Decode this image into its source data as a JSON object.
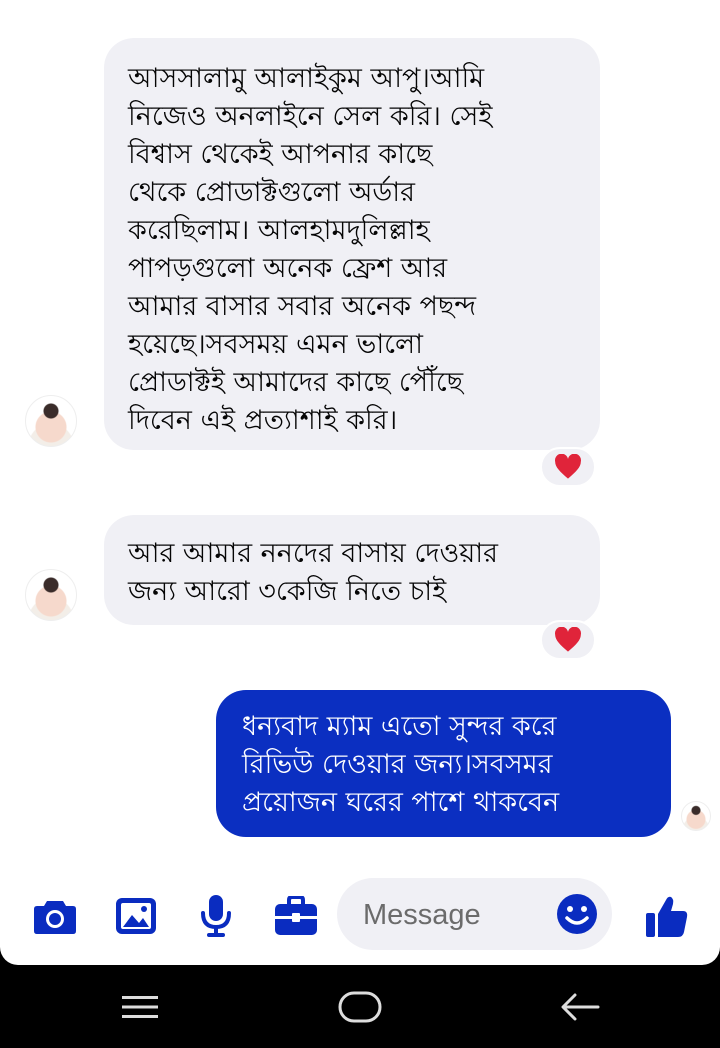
{
  "messages": [
    {
      "sender": "contact",
      "lines": [
        "আসসালামু আলাইকুম আপু।আমি",
        "নিজেও অনলাইনে সেল করি। সেই",
        "বিশ্বাস থেকেই আপনার কাছে",
        "থেকে প্রোডাক্টগুলো অর্ডার",
        "করেছিলাম। আলহামদুলিল্লাহ",
        "পাপড়গুলো  অনেক ফ্রেশ আর",
        "আমার বাসার সবার অনেক পছন্দ",
        "হয়েছে।সবসময় এমন ভালো",
        "প্রোডাক্টই আমাদের কাছে পৌঁছে",
        "দিবেন এই প্রত্যাশাই করি।"
      ],
      "reaction": "heart"
    },
    {
      "sender": "contact",
      "lines": [
        "আর আমার ননদের বাসায় দেওয়ার",
        "জন্য আরো ৩কেজি নিতে চাই"
      ],
      "reaction": "heart"
    },
    {
      "sender": "self",
      "lines": [
        "ধন্যবাদ ম্যাম এতো সুন্দর করে",
        "রিভিউ দেওয়ার জন্য।সবসমর",
        "প্রয়োজন ঘরের পাশে থাকবেন"
      ]
    }
  ],
  "composer": {
    "placeholder": "Message",
    "icons": [
      "camera-icon",
      "image-icon",
      "microphone-icon",
      "briefcase-icon",
      "emoji-icon",
      "thumbs-up-icon"
    ]
  },
  "navigation": {
    "icons": [
      "menu-icon",
      "home-icon",
      "back-icon"
    ]
  },
  "colors": {
    "accent": "#0a2cc0",
    "outgoing_bubble": "#0b2fc1",
    "incoming_bubble": "#f0f0f5",
    "reaction_heart": "#e0243a"
  }
}
